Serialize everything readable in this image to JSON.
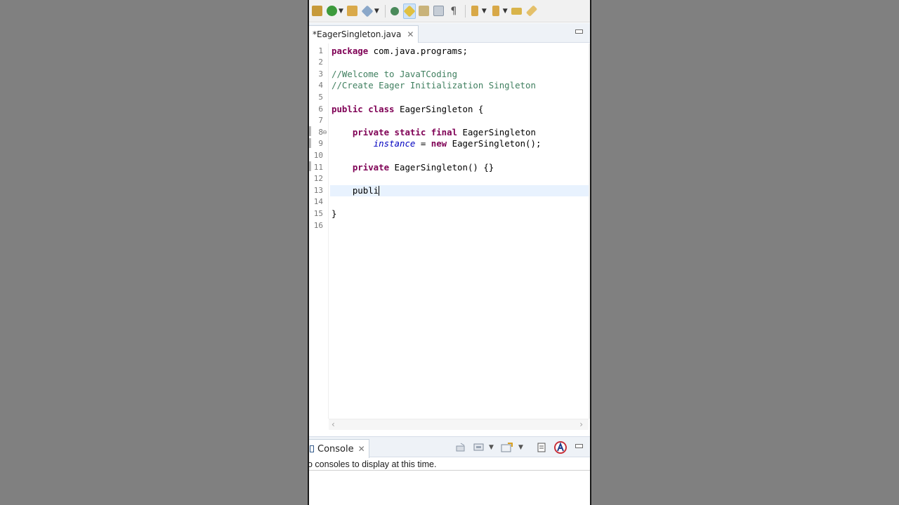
{
  "toolbar": {
    "icons": [
      "package-icon",
      "run-icon",
      "open-type-icon",
      "quick-access-icon",
      "search-icon",
      "highlight-icon",
      "toggle-mark-icon",
      "block-selection-icon",
      "show-whitespace-icon",
      "next-annotation-icon",
      "previous-annotation-icon",
      "back-icon",
      "forward-icon"
    ],
    "pilcrow": "¶"
  },
  "editor": {
    "tab_title": "*EagerSingleton.java",
    "close_glyph": "✕",
    "current_line": 13,
    "lines": [
      {
        "n": "1",
        "text": ""
      },
      {
        "n": "2",
        "text": ""
      },
      {
        "n": "3",
        "text": ""
      },
      {
        "n": "4",
        "text": ""
      },
      {
        "n": "5",
        "text": ""
      },
      {
        "n": "6",
        "text": ""
      },
      {
        "n": "7",
        "text": ""
      },
      {
        "n": "8",
        "text": ""
      },
      {
        "n": "9",
        "text": ""
      },
      {
        "n": "10",
        "text": ""
      },
      {
        "n": "11",
        "text": ""
      },
      {
        "n": "12",
        "text": ""
      },
      {
        "n": "13",
        "text": ""
      },
      {
        "n": "14",
        "text": ""
      },
      {
        "n": "15",
        "text": ""
      },
      {
        "n": "16",
        "text": ""
      }
    ],
    "code": {
      "l1_kw": "package",
      "l1_rest": " com.java.programs;",
      "l3": "//Welcome to JavaTCoding",
      "l4": "//Create Eager Initialization Singleton",
      "l6_kw": "public class",
      "l6_rest": " EagerSingleton {",
      "l8_kw": "private static final",
      "l8_rest": " EagerSingleton",
      "l9_field": "instance",
      "l9_mid": " = ",
      "l9_kw": "new",
      "l9_rest": " EagerSingleton();",
      "l11_kw": "private",
      "l11_rest": " EagerSingleton() {}",
      "l13": "publi",
      "l15": "}"
    }
  },
  "console": {
    "tab_label": "Console",
    "close_glyph": "✕",
    "message": "o consoles to display at this time."
  }
}
